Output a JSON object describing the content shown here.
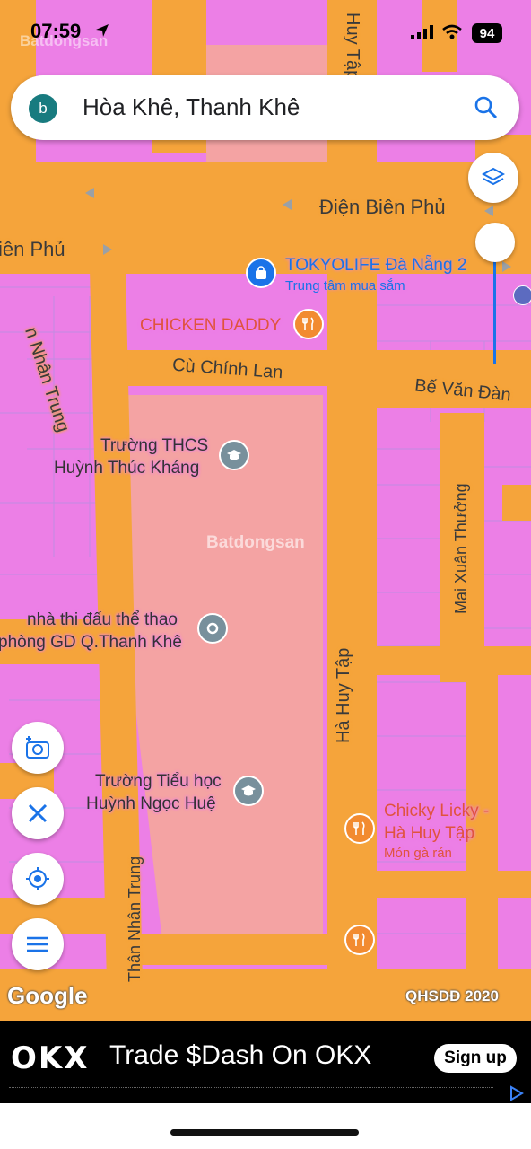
{
  "status_bar": {
    "time": "07:59",
    "battery": "94"
  },
  "search": {
    "avatar_letter": "b",
    "query": "Hòa Khê, Thanh Khê"
  },
  "map": {
    "streets": {
      "dien_bien_phu_right": "Điện Biên Phủ",
      "dien_bien_phu_left": "iên Phủ",
      "ha_huy_tap_top": "Huy Tập",
      "ha_huy_tap": "Hà Huy Tập",
      "cu_chinh_lan": "Cù Chính Lan",
      "be_van_dan": "Bế Văn Đàn",
      "mai_xuan_thuong": "Mai Xuân Thưởng",
      "than_nhan_trung": "Thân Nhân Trung",
      "nhan_trung_top": "n Nhân Trung"
    },
    "pois": {
      "tokyolife": {
        "name": "TOKYOLIFE Đà Nẵng 2",
        "category": "Trung tâm mua sắm"
      },
      "chicken_daddy": {
        "name": "CHICKEN DADDY"
      },
      "thcs": {
        "line1": "Trường THCS",
        "line2": "Huỳnh Thúc Kháng"
      },
      "nha_thi_dau": {
        "line1": "nhà thi đấu thể thao",
        "line2": "phòng GD Q.Thanh Khê"
      },
      "tieu_hoc": {
        "line1": "Trường Tiểu học",
        "line2": "Huỳnh Ngọc Huệ"
      },
      "chicky_licky": {
        "line1": "Chicky Licky -",
        "line2": "Hà Huy Tập",
        "category": "Món gà rán"
      }
    },
    "watermark": "Batdongsan",
    "google_logo": "Google",
    "layer_label": "QHSDĐ 2020"
  },
  "ad": {
    "brand": "OKX",
    "headline": "Trade $Dash On OKX",
    "cta": "Sign up"
  },
  "colors": {
    "road": "#f5a43b",
    "residential": "#ec7fe6",
    "school": "#f4a3a3",
    "accent": "#1a73e8"
  }
}
